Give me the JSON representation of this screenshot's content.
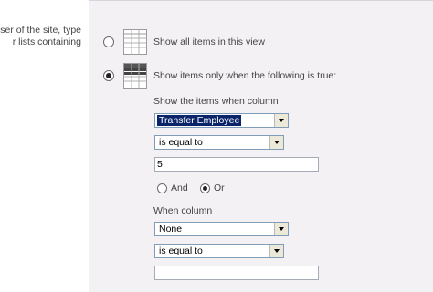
{
  "description": {
    "line1": "ser of the site, type",
    "line2": "r lists containing"
  },
  "options": {
    "show_all_label": "Show all items in this view",
    "show_filtered_label": "Show items only when the following is true:"
  },
  "filter1": {
    "heading": "Show the items when column",
    "column_value": "Transfer Employee",
    "operator_value": "is equal to",
    "value_text": "5"
  },
  "logic": {
    "and_label": "And",
    "or_label": "Or"
  },
  "filter2": {
    "heading": "When column",
    "column_value": "None",
    "operator_value": "is equal to",
    "value_text": ""
  }
}
